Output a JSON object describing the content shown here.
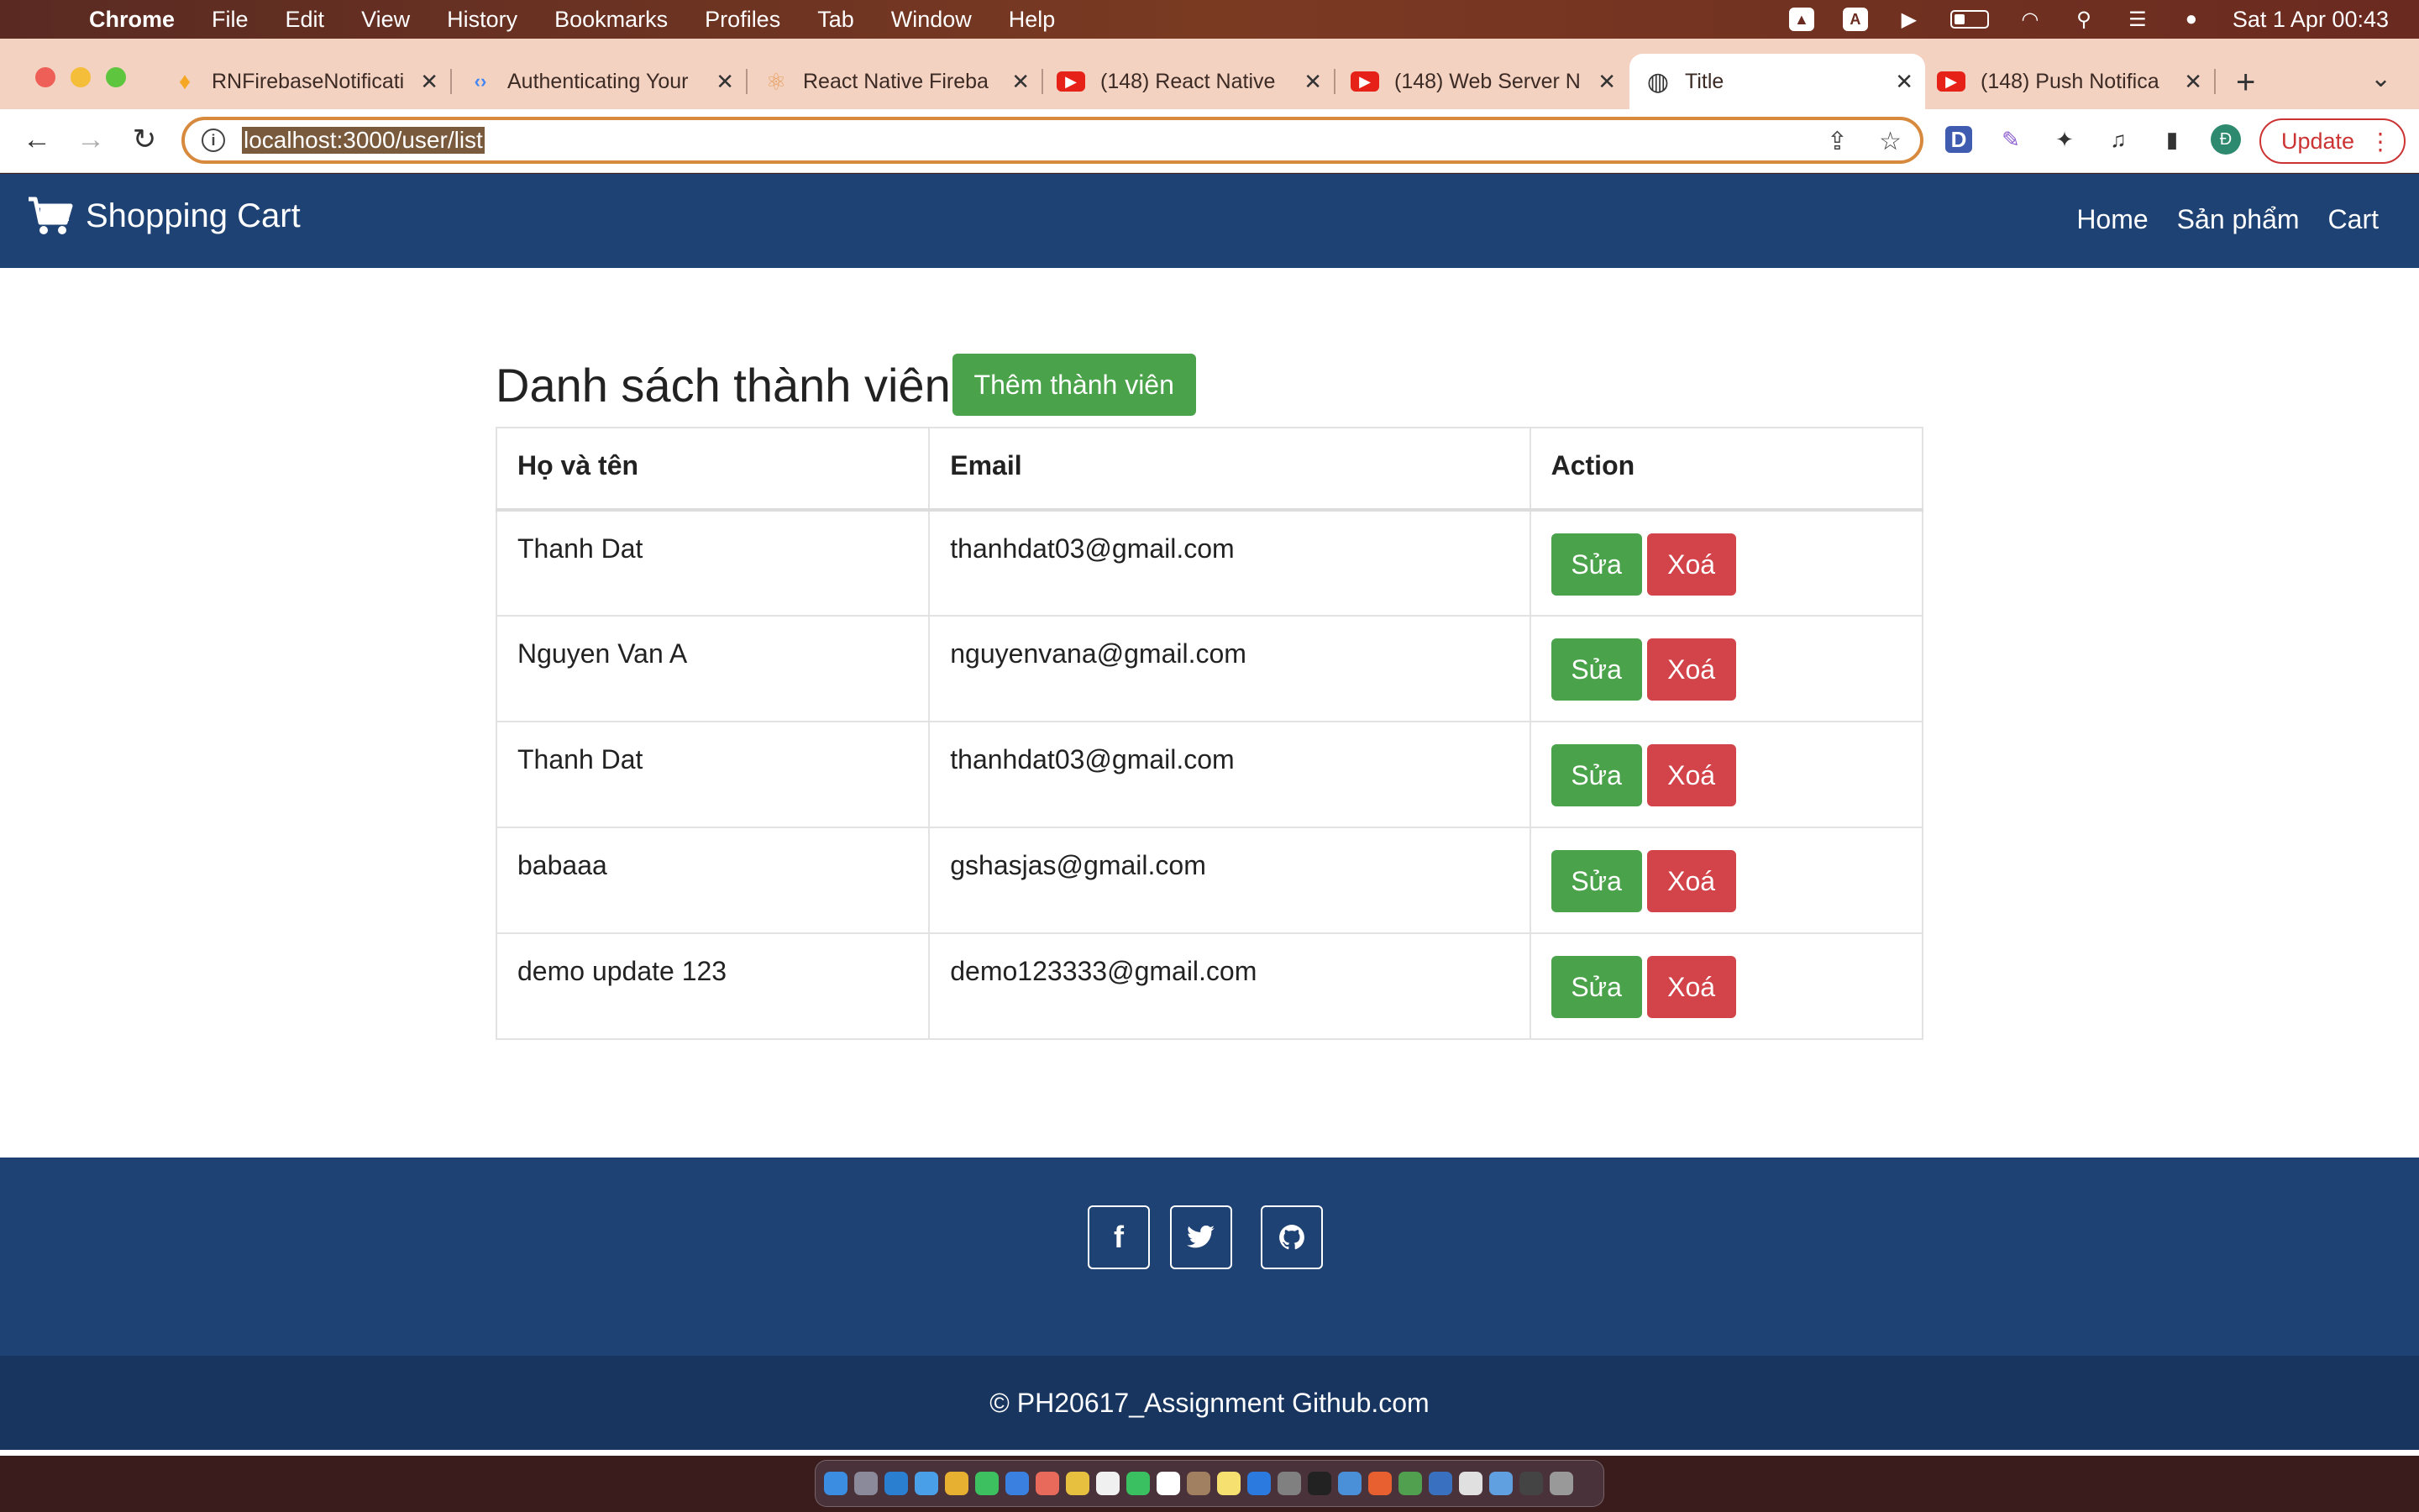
{
  "menubar": {
    "app": "Chrome",
    "items": [
      "File",
      "Edit",
      "View",
      "History",
      "Bookmarks",
      "Profiles",
      "Tab",
      "Window",
      "Help"
    ],
    "datetime": "Sat 1 Apr  00:43"
  },
  "tabs": [
    {
      "title": "RNFirebaseNotificati",
      "icon": "firebase-icon",
      "color": "#f5a623"
    },
    {
      "title": "Authenticating Your",
      "icon": "google-dev-icon",
      "color": "#4285f4"
    },
    {
      "title": "React Native Fireba",
      "icon": "react-icon",
      "color": "#e8a060"
    },
    {
      "title": "(148) React Native",
      "icon": "youtube-icon",
      "color": "#e62117"
    },
    {
      "title": "(148) Web Server N",
      "icon": "youtube-icon",
      "color": "#e62117"
    },
    {
      "title": "Title",
      "icon": "globe-icon",
      "color": "#333333"
    },
    {
      "title": "(148) Push Notifica",
      "icon": "youtube-icon",
      "color": "#e62117"
    }
  ],
  "address_bar": {
    "url": "localhost:3000/user/list"
  },
  "profile_initial": "Đ",
  "update_label": "Update",
  "site": {
    "brand": "Shopping Cart",
    "nav": [
      "Home",
      "Sản phẩm",
      "Cart"
    ],
    "heading": "Danh sách thành viên",
    "add_button": "Thêm thành viên",
    "table": {
      "headers": [
        "Họ và tên",
        "Email",
        "Action"
      ],
      "rows": [
        {
          "name": "Thanh Dat",
          "email": "thanhdat03@gmail.com"
        },
        {
          "name": "Nguyen Van A",
          "email": "nguyenvana@gmail.com"
        },
        {
          "name": "Thanh Dat",
          "email": "thanhdat03@gmail.com"
        },
        {
          "name": "babaaa",
          "email": "gshasjas@gmail.com"
        },
        {
          "name": "demo update 123",
          "email": "demo123333@gmail.com"
        }
      ],
      "edit_label": "Sửa",
      "delete_label": "Xoá"
    },
    "social": [
      "facebook-icon",
      "twitter-icon",
      "github-icon"
    ],
    "copyright": "© PH20617_Assignment Github.com"
  },
  "colors": {
    "navbar": "#1e4274",
    "success": "#4aa24a",
    "danger": "#d2444a",
    "copyright_bar": "#17355f"
  }
}
